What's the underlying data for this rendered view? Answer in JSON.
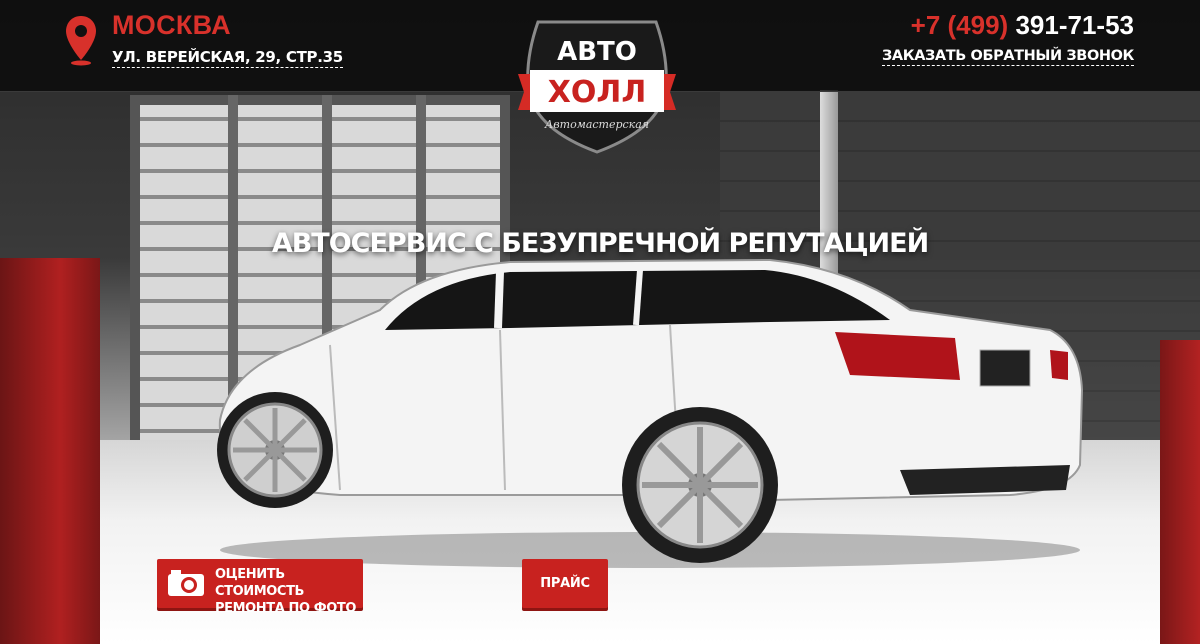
{
  "header": {
    "city": "МОСКВА",
    "address": "УЛ. ВЕРЕЙСКАЯ, 29, СТР.35",
    "phone_code": "+7 (499)",
    "phone_number": "391-71-53",
    "callback_label": "ЗАКАЗАТЬ ОБРАТНЫЙ ЗВОНОК"
  },
  "logo": {
    "line1": "АВТО",
    "line2": "ХОЛЛ",
    "tagline": "Автомастерская"
  },
  "hero": {
    "headline": "АВТОСЕРВИС С БЕЗУПРЕЧНОЙ РЕПУТАЦИЕЙ"
  },
  "buttons": {
    "photo_line1": "ОЦЕНИТЬ СТОИМОСТЬ",
    "photo_line2": "РЕМОНТА ПО ФОТО",
    "price": "ПРАЙС"
  },
  "colors": {
    "accent": "#d8312b",
    "button": "#c8221f"
  },
  "icons": [
    "map-pin-icon",
    "camera-icon"
  ]
}
